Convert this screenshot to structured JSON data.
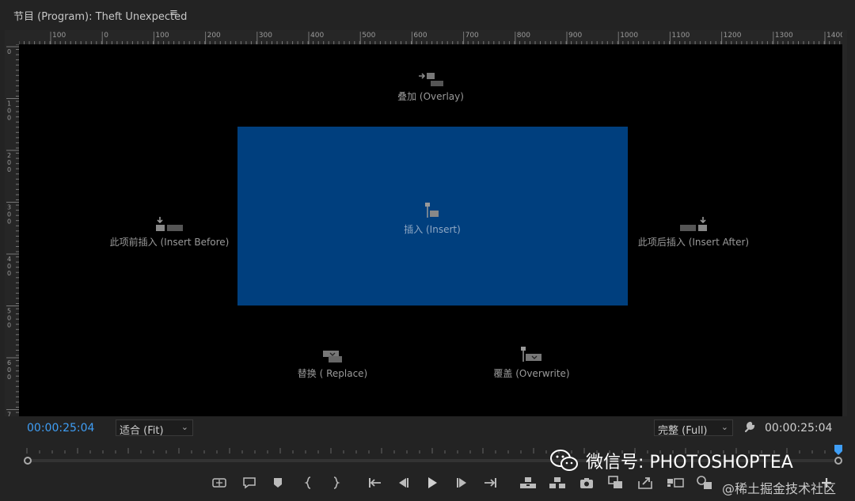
{
  "panel": {
    "title": "节目 (Program): Theft Unexpected",
    "menu_icon": "≡"
  },
  "ruler_top_labels": [
    "100",
    "0",
    "100",
    "200",
    "300",
    "400",
    "500",
    "600",
    "700",
    "800",
    "900",
    "1000",
    "1100",
    "1200",
    "1300",
    "1400"
  ],
  "ruler_left_labels": [
    "0",
    "1\n0\n0",
    "2\n0\n0",
    "3\n0\n0",
    "4\n0\n0",
    "5\n0\n0",
    "6\n0\n0",
    "7"
  ],
  "drop_zones": {
    "overlay": "叠加 (Overlay)",
    "insert": "插入 (Insert)",
    "insert_before": "此项前插入 (Insert Before)",
    "insert_after": "此项后插入 (Insert After)",
    "replace": "替换 ( Replace)",
    "overwrite": "覆盖 (Overwrite)"
  },
  "controls": {
    "timecode_left": "00:00:25:04",
    "fit_value": "适合 (Fit)",
    "quality_value": "完整 (Full)",
    "timecode_right": "00:00:25:04"
  },
  "watermark": {
    "text": "微信号: PHOTOSHOPTEA",
    "source": "@稀土掘金技术社区"
  },
  "colors": {
    "timecode_accent": "#3f9ef5",
    "frame_fill": "#003f7e",
    "playhead": "#3f9ef5"
  },
  "icons": [
    "add-marker-icon",
    "comment-icon",
    "marker-icon",
    "mark-in-icon",
    "mark-out-icon",
    "go-to-in-icon",
    "step-back-icon",
    "play-icon",
    "step-forward-icon",
    "go-to-out-icon",
    "lift-icon",
    "extract-icon",
    "export-frame-icon",
    "comparison-view-icon",
    "export-icon",
    "proxy-toggle-icon",
    "vr-video-icon",
    "add-button-icon"
  ]
}
